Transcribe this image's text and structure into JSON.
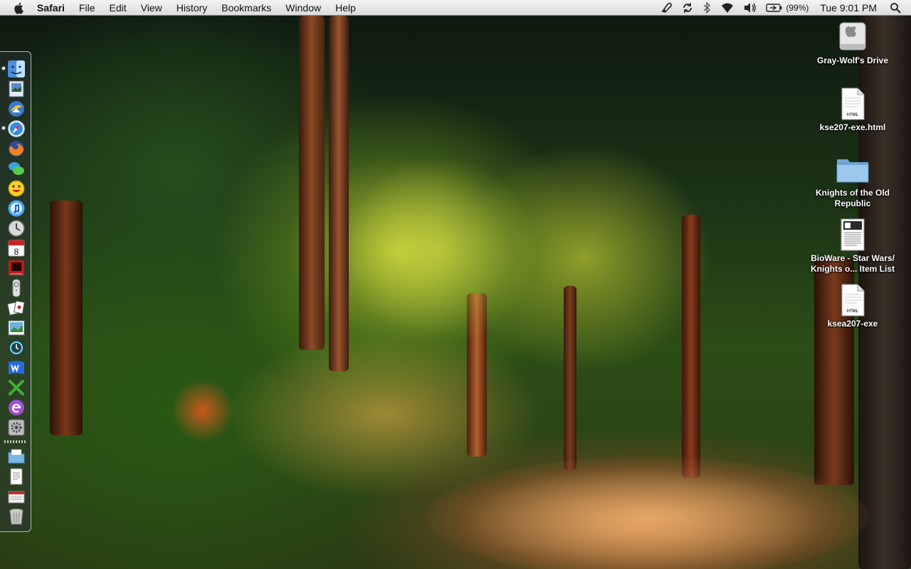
{
  "menubar": {
    "apple_icon": "apple-logo-icon",
    "app_name": "Safari",
    "menus": [
      "File",
      "Edit",
      "View",
      "History",
      "Bookmarks",
      "Window",
      "Help"
    ],
    "status_items": [
      "script-icon",
      "sync-icon",
      "bluetooth-icon",
      "wifi-icon",
      "volume-icon",
      "battery-icon"
    ],
    "battery_percent": "(99%)",
    "clock": "Tue 9:01 PM",
    "spotlight_icon": "spotlight-search-icon"
  },
  "dock": {
    "items": [
      {
        "name": "Finder",
        "icon": "finder-icon",
        "running": true
      },
      {
        "name": "Preview",
        "icon": "preview-icon",
        "running": false
      },
      {
        "name": "Thunderbird",
        "icon": "thunderbird-icon",
        "running": false
      },
      {
        "name": "Safari",
        "icon": "safari-icon",
        "running": true
      },
      {
        "name": "Firefox",
        "icon": "firefox-icon",
        "running": false
      },
      {
        "name": "iChat",
        "icon": "chat-icon",
        "running": false
      },
      {
        "name": "Adium",
        "icon": "smiley-icon",
        "running": false
      },
      {
        "name": "iTunes",
        "icon": "itunes-icon",
        "running": false
      },
      {
        "name": "Time Machine",
        "icon": "clock-icon",
        "running": false
      },
      {
        "name": "iCal",
        "icon": "calendar-icon",
        "calendar_day": "8",
        "running": false
      },
      {
        "name": "Photo Booth",
        "icon": "photo-booth-icon",
        "running": false
      },
      {
        "name": "Remote",
        "icon": "remote-icon",
        "running": false
      },
      {
        "name": "Solitaire",
        "icon": "cards-icon",
        "running": false
      },
      {
        "name": "Photo app",
        "icon": "photo-icon",
        "running": false
      },
      {
        "name": "Time Machine alt",
        "icon": "timemachine-icon",
        "running": false
      },
      {
        "name": "Word",
        "icon": "word-icon",
        "running": false
      },
      {
        "name": "App Green",
        "icon": "green-app-icon",
        "running": false
      },
      {
        "name": "Entourage",
        "icon": "entourage-icon",
        "running": false
      },
      {
        "name": "System Preferences",
        "icon": "system-preferences-icon",
        "running": false
      }
    ],
    "stack_items": [
      {
        "name": "Applications",
        "icon": "folder-stack-icon"
      },
      {
        "name": "Documents",
        "icon": "document-stack-icon"
      },
      {
        "name": "Downloads",
        "icon": "downloads-stack-icon"
      },
      {
        "name": "Trash",
        "icon": "trash-icon"
      }
    ]
  },
  "desktop": {
    "icons": [
      {
        "label": "Gray-Wolf's Drive",
        "icon": "hard-drive-icon"
      },
      {
        "label": "kse207-exe.html",
        "icon": "html-file-icon",
        "badge": "HTML"
      },
      {
        "label": "Knights of the Old Republic",
        "icon": "folder-icon"
      },
      {
        "label": "BioWare - Star Wars/ Knights o... Item List",
        "icon": "webpage-file-icon"
      },
      {
        "label": "ksea207-exe",
        "icon": "html-file-icon",
        "badge": "HTML"
      }
    ]
  }
}
